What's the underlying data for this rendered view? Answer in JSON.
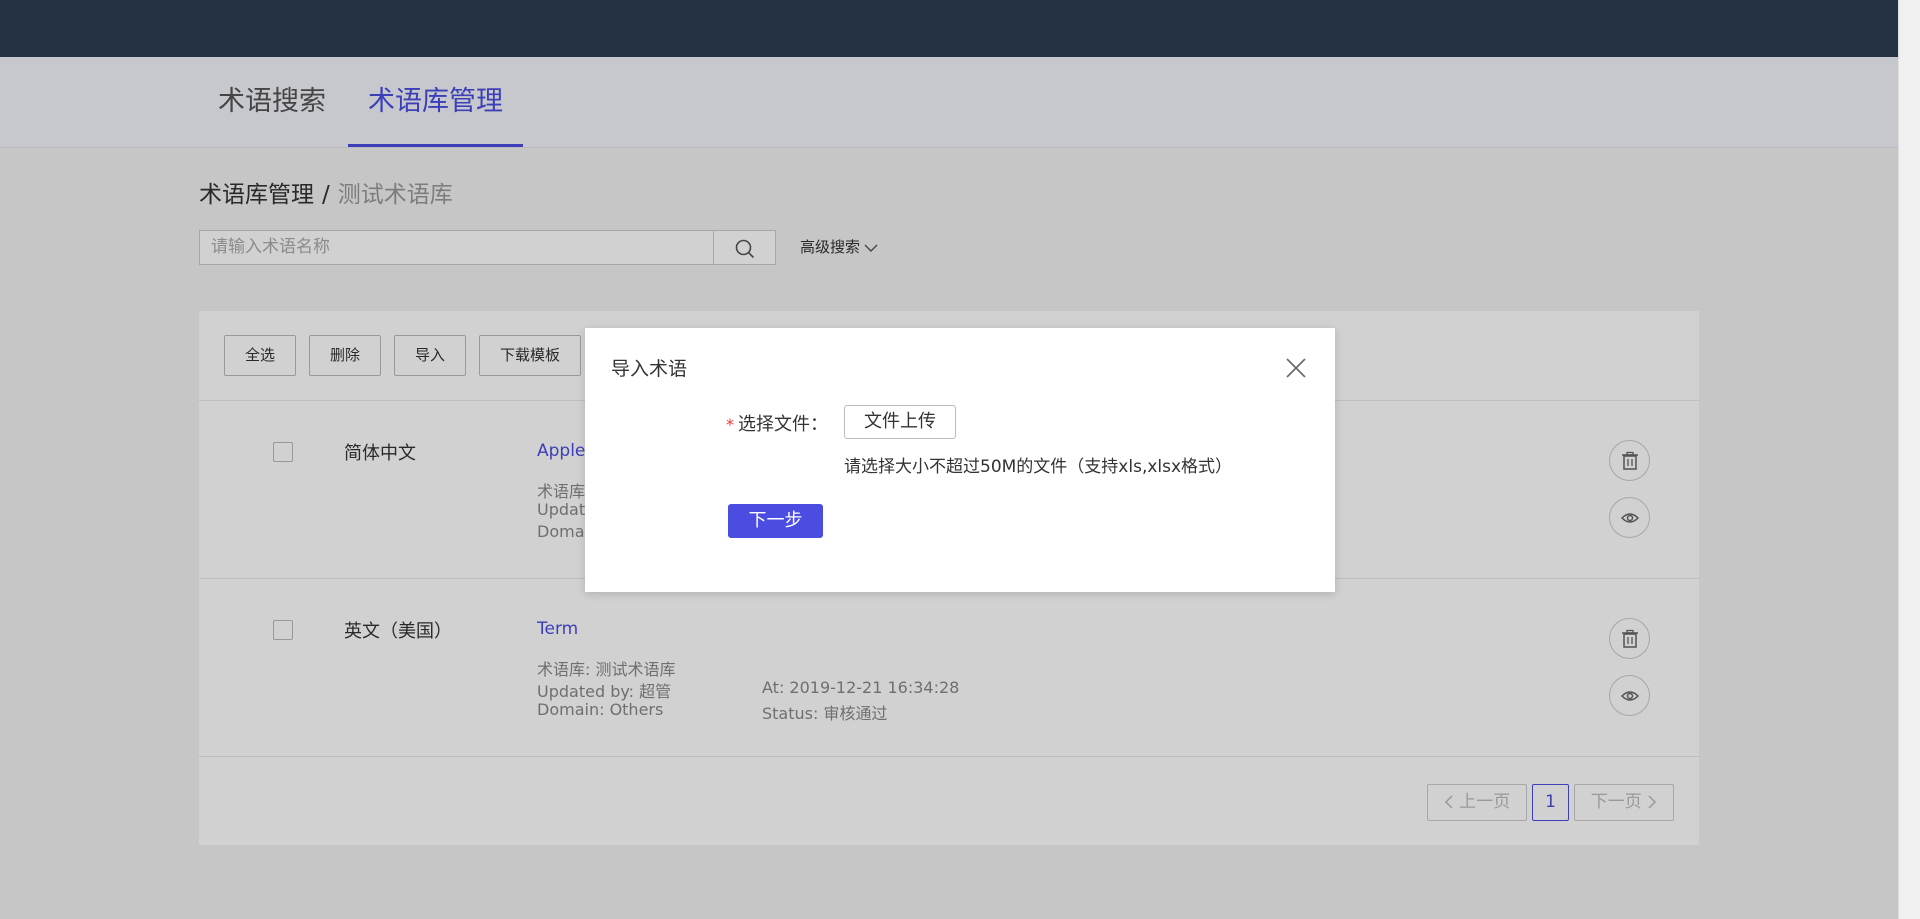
{
  "tabs": [
    {
      "label": "术语搜索"
    },
    {
      "label": "术语库管理"
    }
  ],
  "breadcrumb": {
    "parent": "术语库管理",
    "separator": "/",
    "current": "测试术语库"
  },
  "search": {
    "placeholder": "请输入术语名称",
    "advanced_label": "高级搜索"
  },
  "toolbar": {
    "select_all": "全选",
    "delete": "删除",
    "import": "导入",
    "download_template": "下载模板"
  },
  "rows": [
    {
      "lang": "简体中文",
      "term": "Apple",
      "library": "术语库",
      "updated_by": "Updat",
      "domain": "Doma"
    },
    {
      "lang": "英文（美国）",
      "term": "Term",
      "library": "术语库: 测试术语库",
      "updated_by": "Updated by: 超管",
      "domain": "Domain: Others",
      "at": "At: 2019-12-21 16:34:28",
      "status": "Status: 审核通过"
    }
  ],
  "pager": {
    "prev": "上一页",
    "page": "1",
    "next": "下一页"
  },
  "modal": {
    "title": "导入术语",
    "required_mark": "*",
    "file_label": "选择文件：",
    "upload_label": "文件上传",
    "hint": "请选择大小不超过50M的文件（支持xls,xlsx格式）",
    "next_label": "下一步"
  },
  "colors": {
    "accent": "#4a4de0",
    "topbar": "#2e3d52"
  },
  "icons": [
    "search-icon",
    "chevron-down-icon",
    "trash-icon",
    "eye-icon",
    "close-icon",
    "chevron-left-icon",
    "chevron-right-icon"
  ]
}
